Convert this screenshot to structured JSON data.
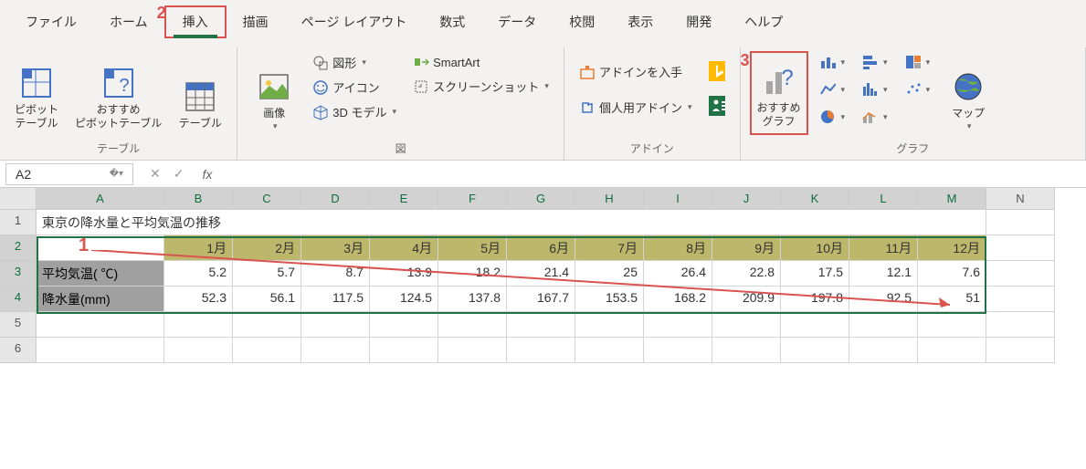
{
  "menu": {
    "items": [
      "ファイル",
      "ホーム",
      "挿入",
      "描画",
      "ページ レイアウト",
      "数式",
      "データ",
      "校閲",
      "表示",
      "開発",
      "ヘルプ"
    ],
    "active_index": 2
  },
  "annotations": {
    "num1": "1",
    "num2": "2",
    "num3": "3"
  },
  "ribbon": {
    "groups": {
      "tables": {
        "label": "テーブル",
        "pivot": "ピボット\nテーブル",
        "recommended_pivot": "おすすめ\nピボットテーブル",
        "table": "テーブル"
      },
      "illustrations": {
        "label": "図",
        "pictures": "画像",
        "shapes": "図形",
        "icons": "アイコン",
        "models3d": "3D モデル",
        "smartart": "SmartArt",
        "screenshot": "スクリーンショット"
      },
      "addins": {
        "label": "アドイン",
        "get": "アドインを入手",
        "my": "個人用アドイン"
      },
      "charts": {
        "label": "グラフ",
        "recommended": "おすすめ\nグラフ",
        "maps": "マップ"
      }
    }
  },
  "formula_bar": {
    "name_box": "A2",
    "fx": "fx",
    "value": ""
  },
  "grid": {
    "col_headers": [
      "A",
      "B",
      "C",
      "D",
      "E",
      "F",
      "G",
      "H",
      "I",
      "J",
      "K",
      "L",
      "M",
      "N"
    ],
    "row_headers": [
      "1",
      "2",
      "3",
      "4",
      "5",
      "6"
    ],
    "title": "東京の降水量と平均気温の推移",
    "months_row_label": "",
    "months": [
      "1月",
      "2月",
      "3月",
      "4月",
      "5月",
      "6月",
      "7月",
      "8月",
      "9月",
      "10月",
      "11月",
      "12月"
    ],
    "row3_label": "平均気温( ℃)",
    "row3_values": [
      "5.2",
      "5.7",
      "8.7",
      "13.9",
      "18.2",
      "21.4",
      "25",
      "26.4",
      "22.8",
      "17.5",
      "12.1",
      "7.6"
    ],
    "row4_label": "降水量(mm)",
    "row4_values": [
      "52.3",
      "56.1",
      "117.5",
      "124.5",
      "137.8",
      "167.7",
      "153.5",
      "168.2",
      "209.9",
      "197.8",
      "92.5",
      "51"
    ]
  },
  "chart_data": {
    "type": "table",
    "title": "東京の降水量と平均気温の推移",
    "categories": [
      "1月",
      "2月",
      "3月",
      "4月",
      "5月",
      "6月",
      "7月",
      "8月",
      "9月",
      "10月",
      "11月",
      "12月"
    ],
    "series": [
      {
        "name": "平均気温( ℃)",
        "values": [
          5.2,
          5.7,
          8.7,
          13.9,
          18.2,
          21.4,
          25,
          26.4,
          22.8,
          17.5,
          12.1,
          7.6
        ]
      },
      {
        "name": "降水量(mm)",
        "values": [
          52.3,
          56.1,
          117.5,
          124.5,
          137.8,
          167.7,
          153.5,
          168.2,
          209.9,
          197.8,
          92.5,
          51
        ]
      }
    ]
  }
}
